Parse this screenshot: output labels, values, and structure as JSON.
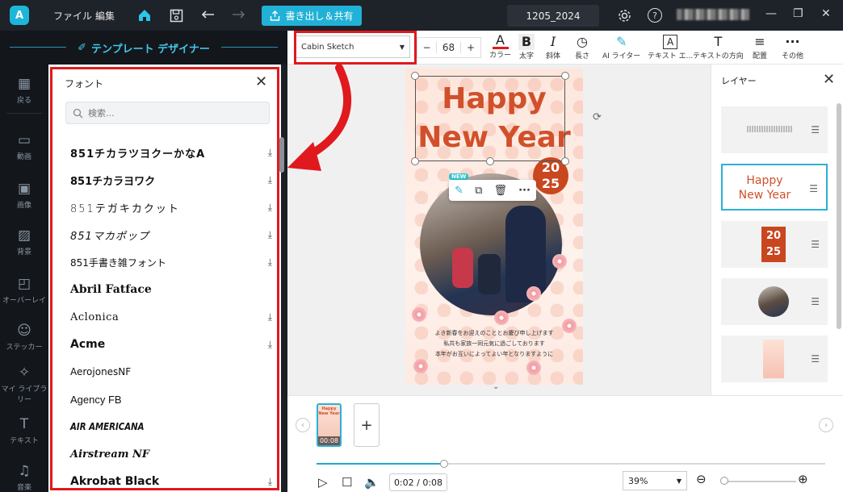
{
  "titlebar": {
    "logo": "A",
    "menu_file": "ファイル",
    "menu_edit": "編集",
    "export_label": "書き出し＆共有",
    "project_name": "1205_2024",
    "settings_icon": "gear-icon",
    "help_icon": "question-icon"
  },
  "designer": {
    "title": "テンプレート デザイナー"
  },
  "sidebar": {
    "items": [
      {
        "label": "戻る",
        "icon": "grid-icon"
      },
      {
        "label": "動画",
        "icon": "video-icon"
      },
      {
        "label": "画像",
        "icon": "image-icon"
      },
      {
        "label": "背景",
        "icon": "background-icon"
      },
      {
        "label": "オーバーレイ",
        "icon": "overlay-icon"
      },
      {
        "label": "ステッカー",
        "icon": "sticker-icon"
      },
      {
        "label": "マイ ライブラリー",
        "icon": "sparkle-icon"
      },
      {
        "label": "テキスト",
        "icon": "text-icon"
      },
      {
        "label": "音楽",
        "icon": "music-icon"
      }
    ]
  },
  "font_panel": {
    "title": "フォント",
    "search_placeholder": "検索...",
    "fonts": [
      {
        "name": "851チカラツヨクーかなA",
        "download": true
      },
      {
        "name": "851チカラヨワク",
        "download": true
      },
      {
        "name": "851テガキカクット",
        "download": true
      },
      {
        "name": "851マカポップ",
        "download": true
      },
      {
        "name": "851手書き雑フォント",
        "download": true
      },
      {
        "name": "Abril Fatface",
        "download": false
      },
      {
        "name": "Aclonica",
        "download": true
      },
      {
        "name": "Acme",
        "download": true
      },
      {
        "name": "AerojonesNF",
        "download": false
      },
      {
        "name": "Agency FB",
        "download": false
      },
      {
        "name": "AIR AMERICANA",
        "download": false
      },
      {
        "name": "Airstream NF",
        "download": false
      },
      {
        "name": "Akrobat Black",
        "download": true
      }
    ]
  },
  "toolbar": {
    "font_family": "Cabin Sketch",
    "font_size": "68",
    "minus": "−",
    "plus": "+",
    "tools": [
      {
        "label": "カラー",
        "glyph": "A"
      },
      {
        "label": "太字",
        "glyph": "B"
      },
      {
        "label": "斜体",
        "glyph": "I"
      },
      {
        "label": "長さ",
        "glyph": "◷"
      },
      {
        "label": "AI ライター",
        "glyph": "✎"
      },
      {
        "label": "テキスト エ...",
        "glyph": "A"
      },
      {
        "label": "テキストの方向",
        "glyph": "T"
      },
      {
        "label": "配置",
        "glyph": "≡"
      },
      {
        "label": "その他",
        "glyph": "···"
      }
    ],
    "accent_color": "#e0191f"
  },
  "canvas": {
    "headline_line1": "Happy",
    "headline_line2": "New Year",
    "year_top": "20",
    "year_bottom": "25",
    "new_tag": "NEW",
    "message_line1": "よき新春をお迎えのこととお慶び申し上げます",
    "message_line2": "私共も家族一同元気に過ごしております",
    "message_line3": "本年がお互いによってよい年となりますように"
  },
  "layers": {
    "title": "レイヤー",
    "items": [
      {
        "type": "text-lines"
      },
      {
        "type": "headline",
        "line1": "Happy",
        "line2": "New Year",
        "active": true
      },
      {
        "type": "year",
        "top": "20",
        "bottom": "25"
      },
      {
        "type": "photo"
      },
      {
        "type": "background"
      }
    ]
  },
  "timeline": {
    "thumb_line1": "Happy",
    "thumb_line2": "New Year",
    "thumb_duration": "00:08",
    "add_label": "+",
    "progress_fraction": 0.25,
    "time_display": "0:02 / 0:08",
    "zoom": "39%"
  }
}
